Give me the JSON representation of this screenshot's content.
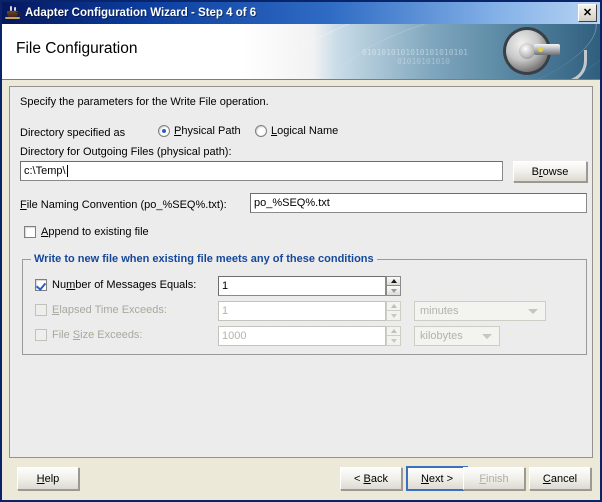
{
  "window": {
    "title": "Adapter Configuration Wizard - Step 4 of 6",
    "icon": "java-coffee-cup-icon",
    "close_label": "✕"
  },
  "banner": {
    "title": "File Configuration",
    "binary_line_1": "0101010101010101010101",
    "binary_line_2": "01010101010",
    "gear_icon": "gear-cable-icon"
  },
  "content": {
    "instruction": "Specify the parameters for the Write File operation.",
    "directory_specified_as_label": "Directory specified as",
    "radio_physical": {
      "label": "Physical Path",
      "mnemonic": "P",
      "selected": true
    },
    "radio_logical": {
      "label": "Logical Name",
      "mnemonic": "L",
      "selected": false
    },
    "directory_label": "Directory for Outgoing Files (physical path):",
    "directory_value": "c:\\Temp\\",
    "browse_label": "Browse",
    "browse_mnemonic": "r",
    "naming_label": "File Naming Convention (po_%SEQ%.txt):",
    "naming_mnemonic": "F",
    "naming_value": "po_%SEQ%.txt",
    "append_label": "Append to existing file",
    "append_mnemonic": "A",
    "append_checked": false
  },
  "conditions_group": {
    "title": "Write to new file when existing file meets any of these conditions",
    "title_color": "#15489a",
    "rows": [
      {
        "label": "Number of Messages Equals:",
        "mnemonic": "m",
        "checked": true,
        "enabled": true,
        "value": "1",
        "unit": null
      },
      {
        "label": "Elapsed Time Exceeds:",
        "mnemonic": "E",
        "checked": false,
        "enabled": false,
        "value": "1",
        "unit": "minutes"
      },
      {
        "label": "File Size Exceeds:",
        "mnemonic": "S",
        "checked": false,
        "enabled": false,
        "value": "1000",
        "unit": "kilobytes"
      }
    ]
  },
  "footer": {
    "help": {
      "label": "Help",
      "mnemonic": "H",
      "enabled": true
    },
    "back": {
      "label": "< Back",
      "mnemonic": "B",
      "enabled": true
    },
    "next": {
      "label": "Next >",
      "mnemonic": "N",
      "enabled": true,
      "focused": true
    },
    "finish": {
      "label": "Finish",
      "mnemonic": "F",
      "enabled": false
    },
    "cancel": {
      "label": "Cancel",
      "mnemonic": "C",
      "enabled": true
    }
  }
}
